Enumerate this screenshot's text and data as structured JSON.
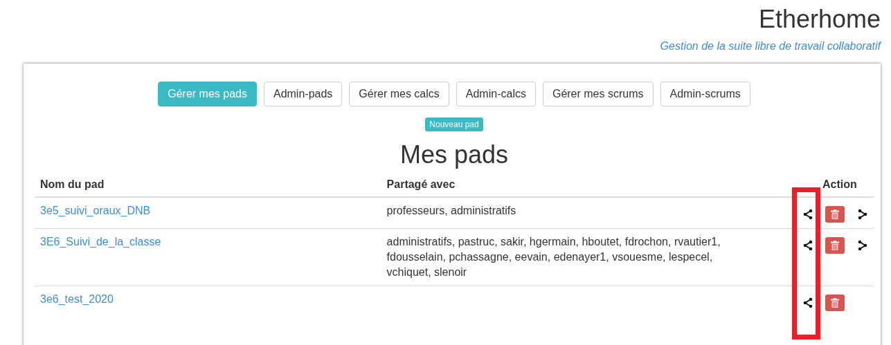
{
  "header": {
    "title": "Etherhome",
    "subtitle": "Gestion de la suite libre de travail collaboratif"
  },
  "nav": [
    {
      "label": "Gérer mes pads",
      "selected": true
    },
    {
      "label": "Admin-pads",
      "selected": false
    },
    {
      "label": "Gérer mes calcs",
      "selected": false
    },
    {
      "label": "Admin-calcs",
      "selected": false
    },
    {
      "label": "Gérer mes scrums",
      "selected": false
    },
    {
      "label": "Admin-scrums",
      "selected": false
    }
  ],
  "new_button": "Nouveau pad",
  "heading": "Mes pads",
  "table": {
    "columns": [
      "Nom du pad",
      "Partagé avec",
      "Action"
    ],
    "rows": [
      {
        "name": "3e5_suivi_oraux_DNB",
        "shared": "professeurs, administratifs",
        "actions": [
          {
            "kind": "share"
          },
          {
            "kind": "delete"
          },
          {
            "kind": "forward"
          }
        ]
      },
      {
        "name": "3E6_Suivi_de_la_classe",
        "shared": "administratifs, pastruc, sakir, hgermain, hboutet, fdrochon, rvautier1, fdousselain, pchassagne, eevain, edenayer1, vsouesme, lespecel, vchiquet, slenoir",
        "actions": [
          {
            "kind": "share"
          },
          {
            "kind": "delete"
          },
          {
            "kind": "forward"
          }
        ]
      },
      {
        "name": "3e6_test_2020",
        "shared": "",
        "actions": [
          {
            "kind": "share"
          },
          {
            "kind": "delete"
          }
        ]
      }
    ]
  }
}
